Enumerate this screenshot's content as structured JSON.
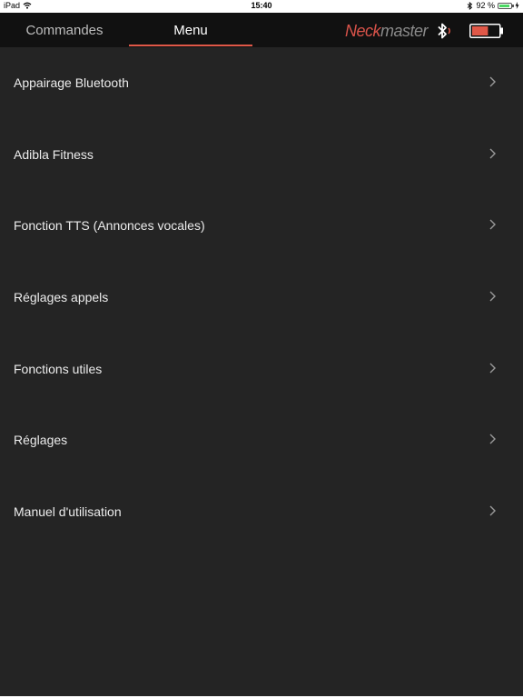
{
  "status_bar": {
    "device": "iPad",
    "time": "15:40",
    "battery_percent": "92 %",
    "battery_level": 0.92
  },
  "top_bar": {
    "tabs": [
      {
        "label": "Commandes",
        "active": false
      },
      {
        "label": "Menu",
        "active": true
      }
    ],
    "brand_part1": "Neck",
    "brand_part2": "master",
    "bluetooth_icon": "bluetooth-icon",
    "battery_icon": "battery-icon",
    "battery_level": 0.6,
    "accent_color": "#e05848"
  },
  "menu": {
    "items": [
      {
        "label": "Appairage Bluetooth"
      },
      {
        "label": "Adibla Fitness"
      },
      {
        "label": "Fonction TTS (Annonces vocales)"
      },
      {
        "label": "Réglages appels"
      },
      {
        "label": "Fonctions utiles"
      },
      {
        "label": "Réglages"
      },
      {
        "label": "Manuel d'utilisation"
      }
    ]
  }
}
